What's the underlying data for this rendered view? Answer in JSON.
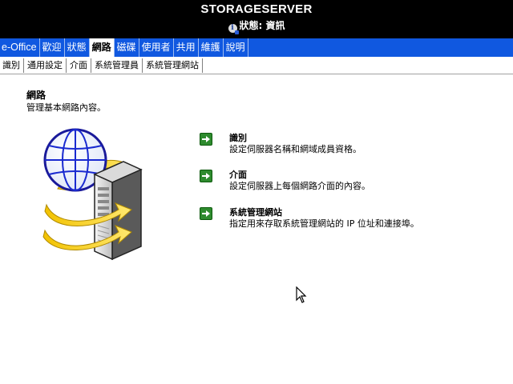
{
  "header": {
    "server_name": "STORAGESERVER",
    "status_text": "狀態: 資訊",
    "status_icon": "info-icon"
  },
  "main_nav": {
    "items": [
      {
        "label": "e-Office",
        "active": false
      },
      {
        "label": "歡迎",
        "active": false
      },
      {
        "label": "狀態",
        "active": false
      },
      {
        "label": "網路",
        "active": true
      },
      {
        "label": "磁碟",
        "active": false
      },
      {
        "label": "使用者",
        "active": false
      },
      {
        "label": "共用",
        "active": false
      },
      {
        "label": "維護",
        "active": false
      },
      {
        "label": "說明",
        "active": false
      }
    ]
  },
  "sub_nav": {
    "items": [
      {
        "label": "識別"
      },
      {
        "label": "通用設定"
      },
      {
        "label": "介面"
      },
      {
        "label": "系統管理員"
      },
      {
        "label": "系統管理網站"
      }
    ]
  },
  "page": {
    "title": "網路",
    "subtitle": "管理基本網路內容。"
  },
  "tasks": [
    {
      "title": "識別",
      "description": "設定伺服器名稱和網域成員資格。",
      "icon": "green-arrow-icon"
    },
    {
      "title": "介面",
      "description": "設定伺服器上每個網路介面的內容。",
      "icon": "green-arrow-icon"
    },
    {
      "title": "系統管理網站",
      "description": "指定用來存取系統管理網站的 IP 位址和連接埠。",
      "icon": "green-arrow-icon"
    }
  ],
  "hero_image": "network-server-globe-icon",
  "colors": {
    "header_bg": "#000000",
    "nav_bg": "#1058e0",
    "task_arrow": "#2e8b2e"
  }
}
